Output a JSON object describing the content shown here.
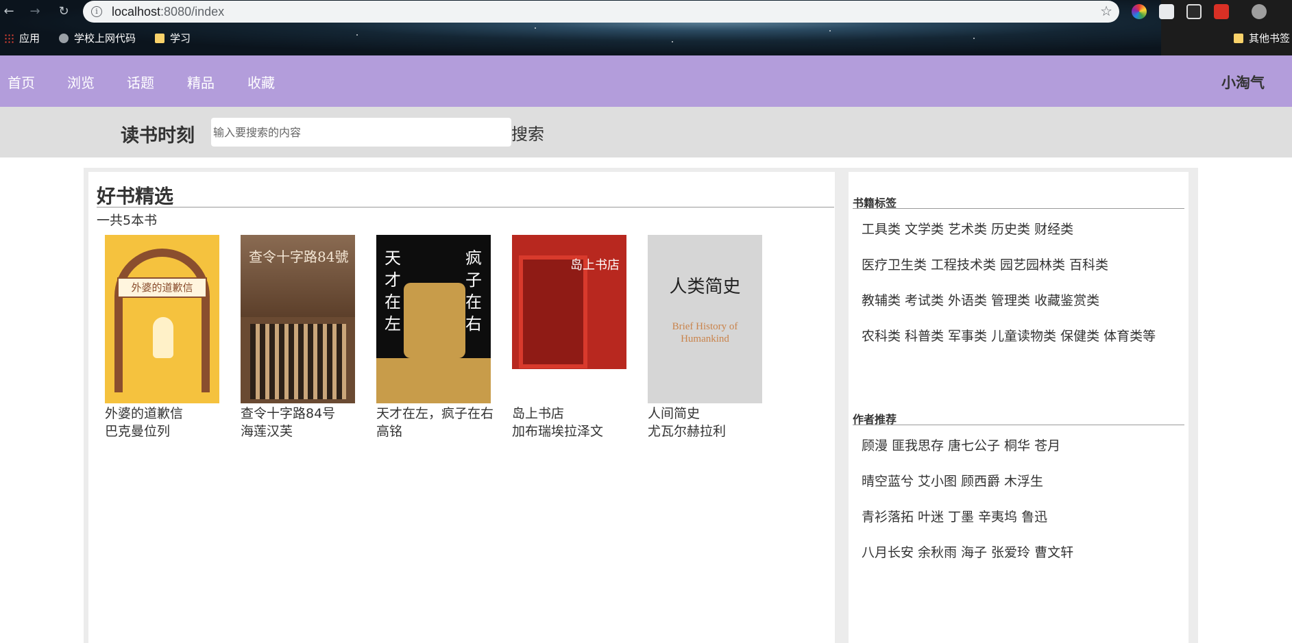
{
  "browser": {
    "url_host": "localhost",
    "url_rest": ":8080/index",
    "bookmarks": [
      "应用",
      "学校上网代码",
      "学习"
    ],
    "bookmarks_right": "其他书签"
  },
  "nav": {
    "items": [
      "首页",
      "浏览",
      "话题",
      "精品",
      "收藏"
    ],
    "user": "小淘气"
  },
  "search": {
    "brand": "读书时刻",
    "placeholder": "输入要搜索的内容",
    "button": "搜索"
  },
  "main": {
    "title": "好书精选",
    "count": "一共5本书",
    "books": [
      {
        "title": "外婆的道歉信",
        "author": "巴克曼位列",
        "cover_text": "外婆的道歉信"
      },
      {
        "title": "查令十字路84号",
        "author": "海莲汉芙",
        "cover_text": "查令十字路84號"
      },
      {
        "title": "天才在左，疯子在右",
        "author": "高铭",
        "cover_text": "天才在左 疯子在右"
      },
      {
        "title": "岛上书店",
        "author": "加布瑞埃拉泽文",
        "cover_text": "岛上书店"
      },
      {
        "title": "人间简史",
        "author": "尤瓦尔赫拉利",
        "cover_text": "人类简史",
        "cover_text_en": "Brief History of Humankind"
      }
    ]
  },
  "sidebar": {
    "tags_title": "书籍标签",
    "tag_rows": [
      [
        "工具类",
        "文学类",
        "艺术类",
        "历史类",
        "财经类"
      ],
      [
        "医疗卫生类",
        "工程技术类",
        "园艺园林类",
        "百科类"
      ],
      [
        "教辅类",
        "考试类",
        "外语类",
        "管理类",
        "收藏鉴赏类"
      ],
      [
        "农科类",
        "科普类",
        "军事类",
        "儿童读物类",
        "保健类",
        "体育类等"
      ]
    ],
    "authors_title": "作者推荐",
    "author_rows": [
      [
        "顾漫",
        "匪我思存",
        "唐七公子",
        "桐华",
        "苍月"
      ],
      [
        "晴空蓝兮",
        "艾小图",
        "顾西爵",
        "木浮生"
      ],
      [
        "青衫落拓",
        "叶迷",
        "丁墨",
        "辛夷坞",
        "鲁迅"
      ],
      [
        "八月长安",
        "余秋雨",
        "海子",
        "张爱玲",
        "曹文轩"
      ]
    ]
  }
}
